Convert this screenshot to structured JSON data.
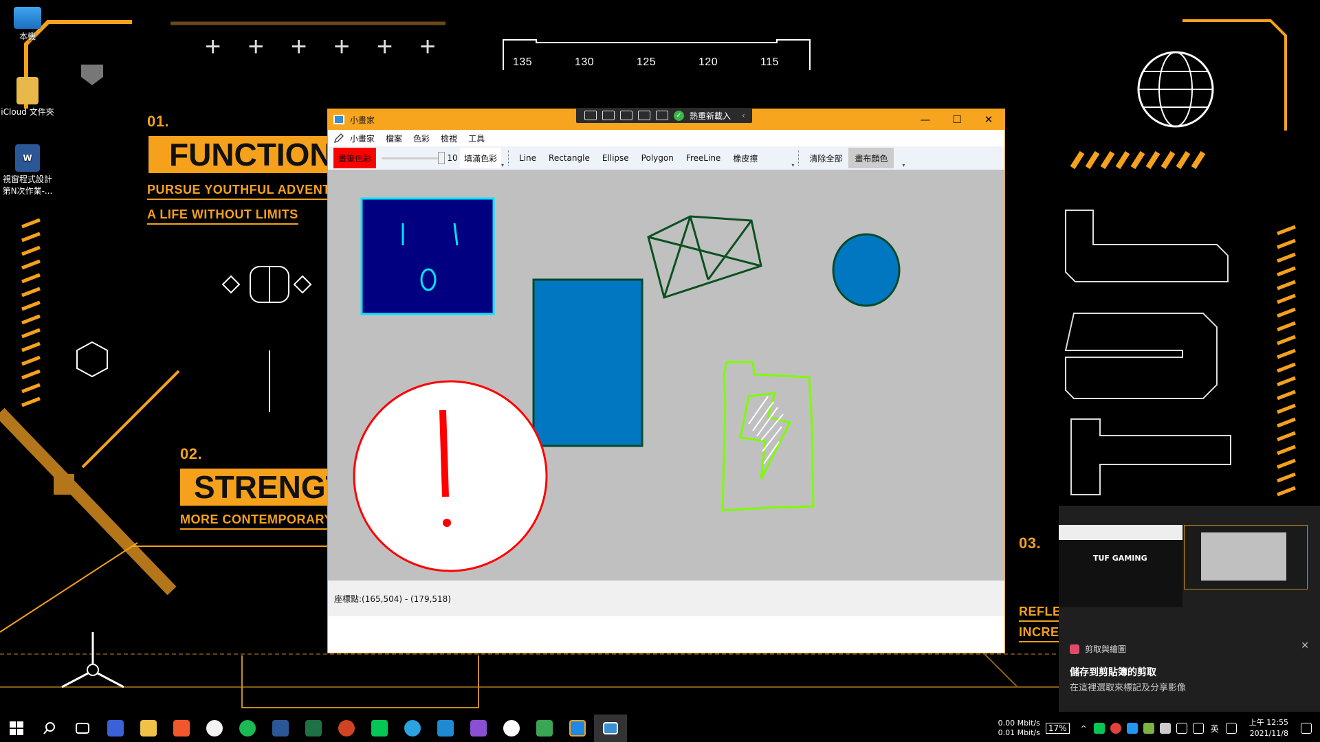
{
  "desktop": {
    "icons": [
      {
        "label": "本機"
      },
      {
        "label": "iCloud 文件夾"
      },
      {
        "label": "視窗程式設計第N次作業-..."
      }
    ],
    "wallpaper": {
      "num1": "01.",
      "word1": "FUNCTIONAL",
      "sub1a": "PURSUE YOUTHFUL ADVENTURE",
      "sub1b": "A LIFE WITHOUT LIMITS",
      "num2": "02.",
      "word2": "STRENGTH",
      "sub2": "MORE CONTEMPORARY",
      "num3": "03.",
      "sub3a": "REFLEC",
      "sub3b": "INCREA",
      "ruler": [
        "135",
        "130",
        "125",
        "120",
        "115"
      ],
      "plus_marks": "+ + + + + +"
    }
  },
  "snip_toolbar": {
    "label": "熱重新載入"
  },
  "window": {
    "title": "小畫家",
    "min_glyph": "—",
    "max_glyph": "☐",
    "close_glyph": "✕"
  },
  "menu": {
    "items": [
      "小畫家",
      "檔案",
      "色彩",
      "檢視",
      "工具"
    ]
  },
  "toolbar": {
    "pen_color_label": "畫筆色彩",
    "pen_size": "10",
    "fill_color_label": "填滿色彩",
    "tools": [
      "Line",
      "Rectangle",
      "Ellipse",
      "Polygon",
      "FreeLine",
      "橡皮擦"
    ],
    "clear_all": "清除全部",
    "canvas_color": "畫布顏色"
  },
  "status": {
    "coords": "座標點:(165,504) - (179,518)"
  },
  "toast": {
    "app": "剪取與繪圖",
    "heading": "儲存到剪貼簿的剪取",
    "body": "在這裡選取來標記及分享影像",
    "thumb_label": "TUF GAMING",
    "close_glyph": "✕"
  },
  "taskbar": {
    "net_up": "0.00 Mbit/s",
    "net_down": "0.01 Mbit/s",
    "cpu": "17%",
    "ime": "英",
    "time": "上午 12:55",
    "date": "2021/11/8",
    "tray_chevron": "^"
  },
  "colors": {
    "accent_orange": "#f7a41e",
    "canvas_gray": "#c0c0c0",
    "pen_red": "#ff0000"
  }
}
